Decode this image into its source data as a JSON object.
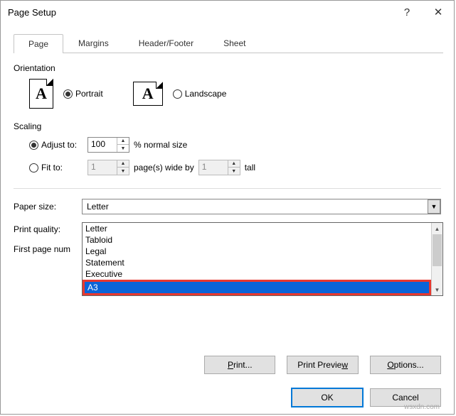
{
  "window": {
    "title": "Page Setup",
    "help": "?",
    "close": "✕"
  },
  "tabs": {
    "page": "Page",
    "margins": "Margins",
    "header_footer": "Header/Footer",
    "sheet": "Sheet"
  },
  "orientation": {
    "label": "Orientation",
    "portrait": "Portrait",
    "landscape": "Landscape",
    "icon_text": "A"
  },
  "scaling": {
    "label": "Scaling",
    "adjust_to": "Adjust to:",
    "adjust_value": "100",
    "adjust_suffix": "% normal size",
    "fit_to": "Fit to:",
    "fit_wide": "1",
    "fit_wide_suffix": "page(s) wide by",
    "fit_tall": "1",
    "fit_tall_suffix": "tall"
  },
  "paper_size": {
    "label": "Paper size:",
    "value": "Letter",
    "options": [
      "Letter",
      "Tabloid",
      "Legal",
      "Statement",
      "Executive",
      "A3"
    ],
    "highlighted": "A3"
  },
  "print_quality": {
    "label": "Print quality:"
  },
  "first_page": {
    "label": "First page num"
  },
  "buttons": {
    "print": "Print...",
    "print_preview": "Print Preview",
    "options": "Options...",
    "ok": "OK",
    "cancel": "Cancel"
  },
  "watermark": "wsxdn.com"
}
